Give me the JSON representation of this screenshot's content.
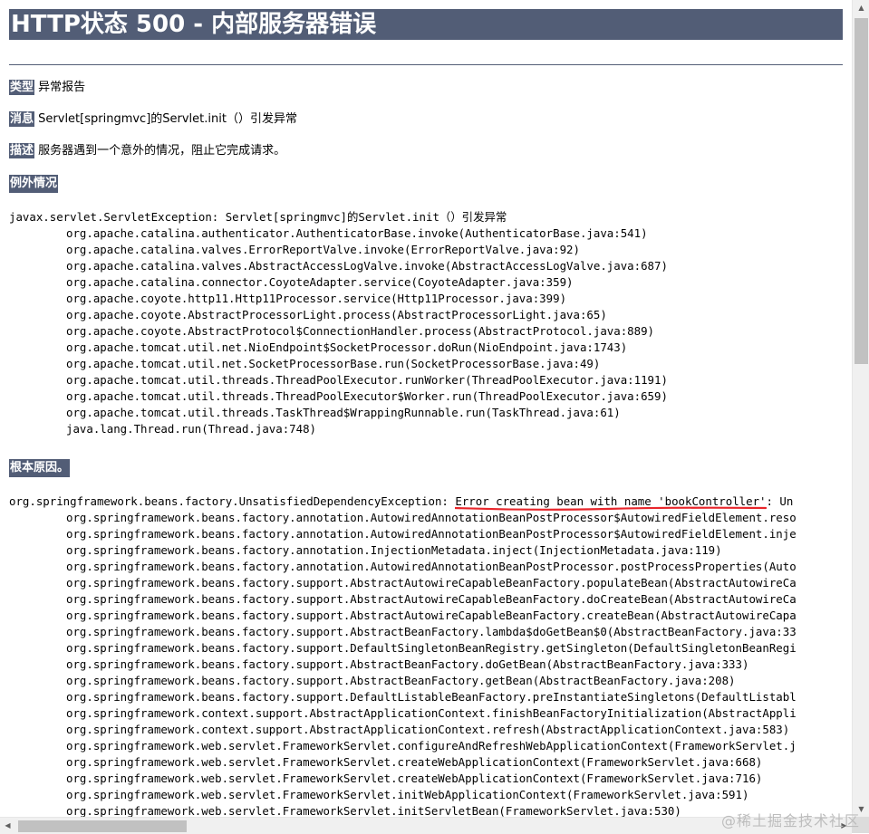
{
  "title": "HTTP状态 500 - 内部服务器错误",
  "fields": {
    "type_label": "类型",
    "type_value": "异常报告",
    "message_label": "消息",
    "message_value": "Servlet[springmvc]的Servlet.init（）引发异常",
    "description_label": "描述",
    "description_value": "服务器遇到一个意外的情况，阻止它完成请求。"
  },
  "exception_section": {
    "title": "例外情况",
    "head": "javax.servlet.ServletException: Servlet[springmvc]的Servlet.init（）引发异常",
    "frames": [
      "org.apache.catalina.authenticator.AuthenticatorBase.invoke(AuthenticatorBase.java:541)",
      "org.apache.catalina.valves.ErrorReportValve.invoke(ErrorReportValve.java:92)",
      "org.apache.catalina.valves.AbstractAccessLogValve.invoke(AbstractAccessLogValve.java:687)",
      "org.apache.catalina.connector.CoyoteAdapter.service(CoyoteAdapter.java:359)",
      "org.apache.coyote.http11.Http11Processor.service(Http11Processor.java:399)",
      "org.apache.coyote.AbstractProcessorLight.process(AbstractProcessorLight.java:65)",
      "org.apache.coyote.AbstractProtocol$ConnectionHandler.process(AbstractProtocol.java:889)",
      "org.apache.tomcat.util.net.NioEndpoint$SocketProcessor.doRun(NioEndpoint.java:1743)",
      "org.apache.tomcat.util.net.SocketProcessorBase.run(SocketProcessorBase.java:49)",
      "org.apache.tomcat.util.threads.ThreadPoolExecutor.runWorker(ThreadPoolExecutor.java:1191)",
      "org.apache.tomcat.util.threads.ThreadPoolExecutor$Worker.run(ThreadPoolExecutor.java:659)",
      "org.apache.tomcat.util.threads.TaskThread$WrappingRunnable.run(TaskThread.java:61)",
      "java.lang.Thread.run(Thread.java:748)"
    ]
  },
  "root_cause_section": {
    "title": "根本原因。",
    "head_prefix": "org.springframework.beans.factory.UnsatisfiedDependencyException: ",
    "head_highlight": "Error creating bean with name 'bookController'",
    "head_suffix": ": Un",
    "highlight_color": "#e8262b",
    "frames": [
      "org.springframework.beans.factory.annotation.AutowiredAnnotationBeanPostProcessor$AutowiredFieldElement.reso",
      "org.springframework.beans.factory.annotation.AutowiredAnnotationBeanPostProcessor$AutowiredFieldElement.inje",
      "org.springframework.beans.factory.annotation.InjectionMetadata.inject(InjectionMetadata.java:119)",
      "org.springframework.beans.factory.annotation.AutowiredAnnotationBeanPostProcessor.postProcessProperties(Auto",
      "org.springframework.beans.factory.support.AbstractAutowireCapableBeanFactory.populateBean(AbstractAutowireCa",
      "org.springframework.beans.factory.support.AbstractAutowireCapableBeanFactory.doCreateBean(AbstractAutowireCa",
      "org.springframework.beans.factory.support.AbstractAutowireCapableBeanFactory.createBean(AbstractAutowireCapa",
      "org.springframework.beans.factory.support.AbstractBeanFactory.lambda$doGetBean$0(AbstractBeanFactory.java:33",
      "org.springframework.beans.factory.support.DefaultSingletonBeanRegistry.getSingleton(DefaultSingletonBeanRegi",
      "org.springframework.beans.factory.support.AbstractBeanFactory.doGetBean(AbstractBeanFactory.java:333)",
      "org.springframework.beans.factory.support.AbstractBeanFactory.getBean(AbstractBeanFactory.java:208)",
      "org.springframework.beans.factory.support.DefaultListableBeanFactory.preInstantiateSingletons(DefaultListabl",
      "org.springframework.context.support.AbstractApplicationContext.finishBeanFactoryInitialization(AbstractAppli",
      "org.springframework.context.support.AbstractApplicationContext.refresh(AbstractApplicationContext.java:583)",
      "org.springframework.web.servlet.FrameworkServlet.configureAndRefreshWebApplicationContext(FrameworkServlet.j",
      "org.springframework.web.servlet.FrameworkServlet.createWebApplicationContext(FrameworkServlet.java:668)",
      "org.springframework.web.servlet.FrameworkServlet.createWebApplicationContext(FrameworkServlet.java:716)",
      "org.springframework.web.servlet.FrameworkServlet.initWebApplicationContext(FrameworkServlet.java:591)",
      "org.springframework.web.servlet.FrameworkServlet.initServletBean(FrameworkServlet.java:530)"
    ]
  },
  "watermark": "@稀土掘金技术社区",
  "scrollbars": {
    "vertical_arrow_up": "▲",
    "vertical_arrow_down": "▼",
    "horizontal_arrow_left": "◀",
    "horizontal_arrow_right": "▶"
  }
}
